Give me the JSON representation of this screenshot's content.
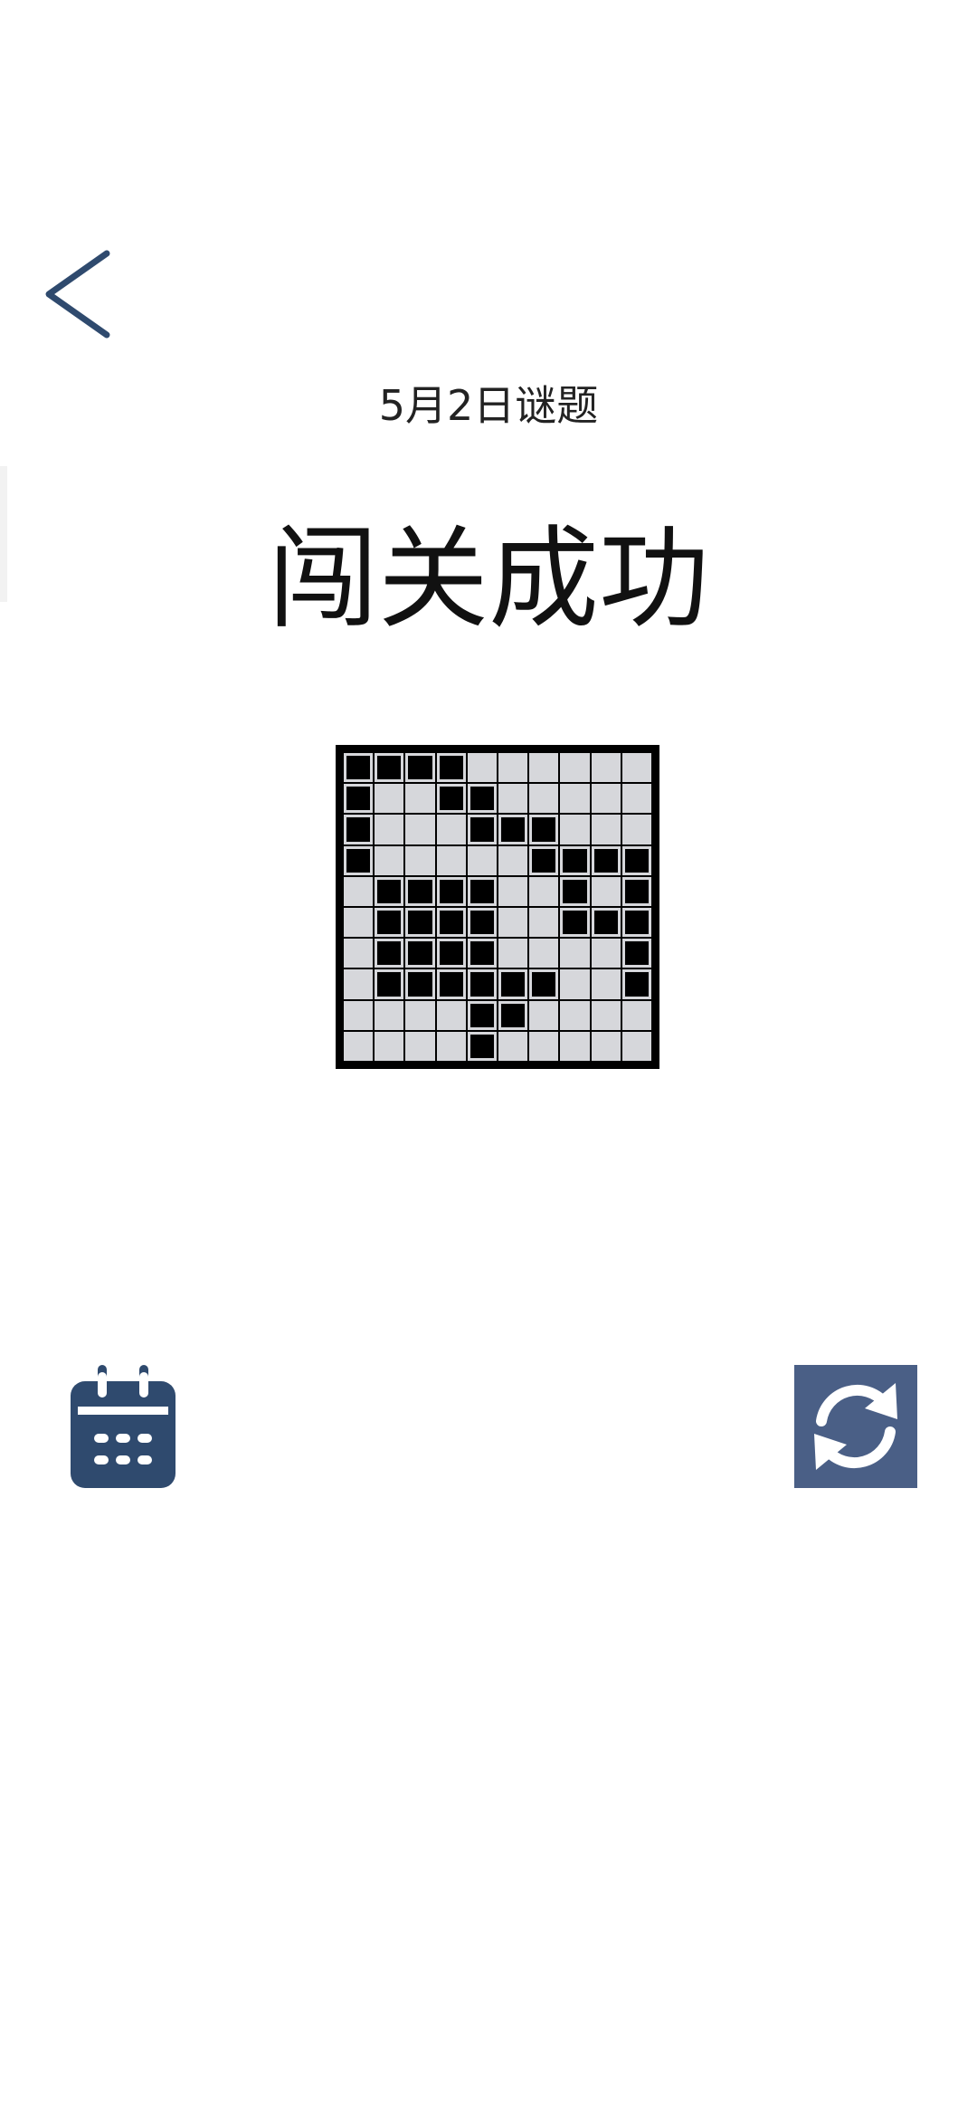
{
  "header": {
    "back_icon": "chevron-left-icon",
    "date_label": "5月2日谜题",
    "title": "闯关成功"
  },
  "puzzle": {
    "rows": 10,
    "cols": 10,
    "grid": [
      [
        1,
        1,
        1,
        1,
        0,
        0,
        0,
        0,
        0,
        0
      ],
      [
        1,
        0,
        0,
        1,
        1,
        0,
        0,
        0,
        0,
        0
      ],
      [
        1,
        0,
        0,
        0,
        1,
        1,
        1,
        0,
        0,
        0
      ],
      [
        1,
        0,
        0,
        0,
        0,
        0,
        1,
        1,
        1,
        1
      ],
      [
        0,
        1,
        1,
        1,
        1,
        0,
        0,
        1,
        0,
        1
      ],
      [
        0,
        1,
        1,
        1,
        1,
        0,
        0,
        1,
        1,
        1
      ],
      [
        0,
        1,
        1,
        1,
        1,
        0,
        0,
        0,
        0,
        1
      ],
      [
        0,
        1,
        1,
        1,
        1,
        1,
        1,
        0,
        0,
        1
      ],
      [
        0,
        0,
        0,
        0,
        1,
        1,
        0,
        0,
        0,
        0
      ],
      [
        0,
        0,
        0,
        0,
        1,
        0,
        0,
        0,
        0,
        0
      ]
    ],
    "filled_color": "#000000",
    "empty_color": "#d6d7db"
  },
  "actions": {
    "calendar_icon": "calendar-icon",
    "refresh_icon": "refresh-icon"
  },
  "colors": {
    "accent": "#2f4a6e",
    "refresh_bg": "#4a5f86"
  }
}
